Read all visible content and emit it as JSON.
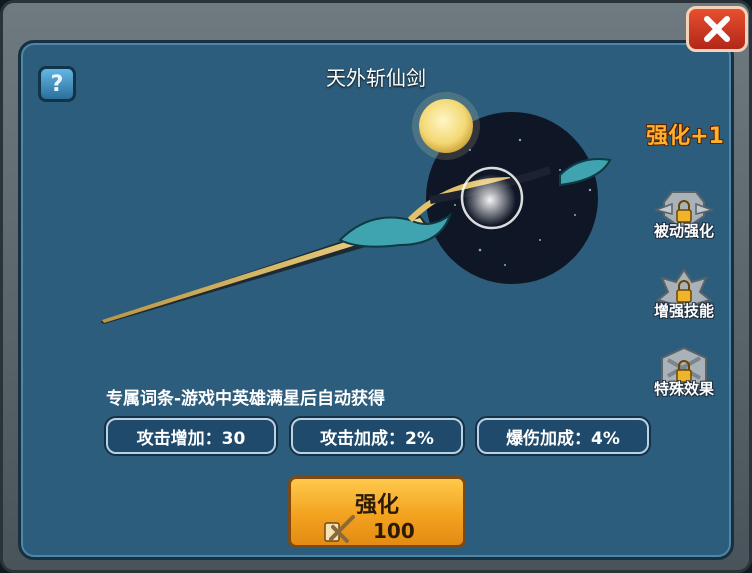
{
  "weapon_name": "天外斩仙剑",
  "help_label": "?",
  "enhance_level": "强化+1",
  "side_slots": [
    {
      "label": "被动强化",
      "icon": "locked-passive-icon"
    },
    {
      "label": "增强技能",
      "icon": "locked-skill-icon"
    },
    {
      "label": "特殊效果",
      "icon": "locked-effect-icon"
    }
  ],
  "exclusive_note": "专属词条-游戏中英雄满星后自动获得",
  "stats": [
    {
      "text": "攻击增加：30"
    },
    {
      "text": "攻击加成：2%"
    },
    {
      "text": "爆伤加成：4%"
    }
  ],
  "enhance_button": {
    "label": "强化",
    "cost": "100",
    "icon": "enhance-stone-icon"
  },
  "colors": {
    "panel": "#2d5d7c",
    "button": "#f3a21f",
    "close": "#d43c24",
    "level_text": "#ffb12b"
  }
}
